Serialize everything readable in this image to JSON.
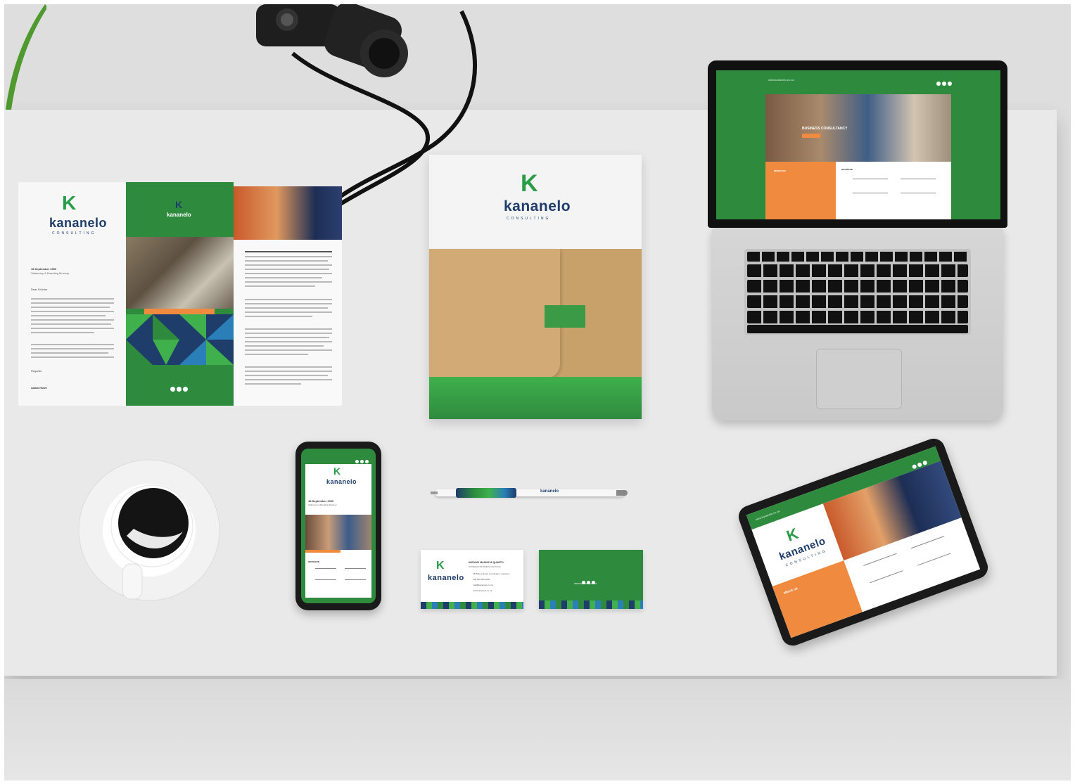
{
  "brand": {
    "logo_letter": "K",
    "name": "kananelo",
    "tagline": "CONSULTING",
    "colors": {
      "green": "#2e8b3e",
      "light_green": "#3fb04c",
      "navy": "#1f3d6b",
      "orange": "#ef8a3f"
    }
  },
  "letterhead": {
    "date": "18 September 2000",
    "subtitle": "Stationery & Branding Mockup",
    "greeting": "Dear Scholar",
    "closing": "Regards",
    "signature": "Adam Howe"
  },
  "laptop_site": {
    "url": "www.kananelo.co.za",
    "hero_text": "BUSINESS CONSULTANCY",
    "about_heading": "about us",
    "services_heading": "services"
  },
  "business_card": {
    "name_line": "NATANCI MASHOYA QUARTO",
    "title_line": "POWERED BUSINESS ADVISOR",
    "lines": [
      "18 Blaney Road, Leamington, Gauteng",
      "+00 000 000 0000",
      "mail@kananelo.co.za",
      "www.kananelo.co.za"
    ],
    "back_url": "www.kananelo.co.za"
  },
  "pen": {
    "label": "kananelo"
  },
  "phone": {
    "date": "18 September 2000",
    "subtitle": "Stationery & Branding Mockup",
    "services_heading": "services"
  },
  "tablet": {
    "url": "www.kananelo.co.za",
    "about_heading": "about us"
  },
  "icons": [
    "facebook-icon",
    "twitter-icon",
    "linkedin-icon",
    "camera-icon",
    "coffee-cup-icon",
    "pen-icon"
  ]
}
